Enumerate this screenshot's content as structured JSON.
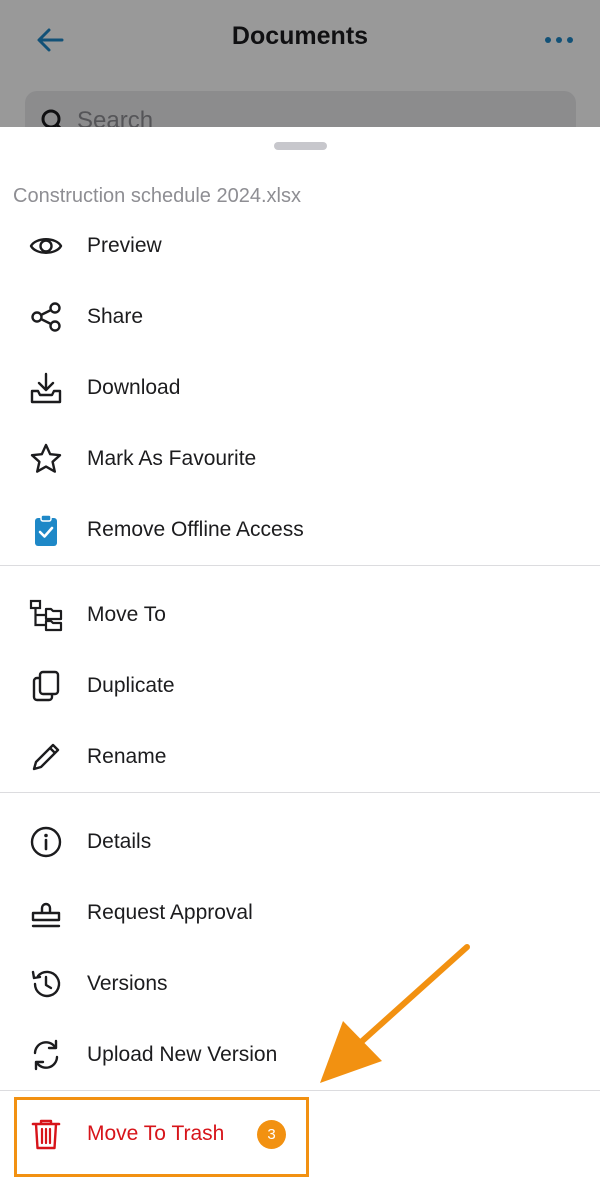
{
  "header": {
    "title": "Documents",
    "back_icon": "arrow-left-icon",
    "more_icon": "more-horizontal-icon"
  },
  "search": {
    "placeholder": "Search",
    "icon": "search-icon"
  },
  "sheet": {
    "file_name": "Construction schedule 2024.xlsx",
    "groups": [
      [
        {
          "label": "Preview",
          "icon": "eye-icon"
        },
        {
          "label": "Share",
          "icon": "share-icon"
        },
        {
          "label": "Download",
          "icon": "download-icon"
        },
        {
          "label": "Mark As Favourite",
          "icon": "star-icon"
        },
        {
          "label": "Remove Offline Access",
          "icon": "clipboard-check-icon"
        }
      ],
      [
        {
          "label": "Move To",
          "icon": "move-folder-icon"
        },
        {
          "label": "Duplicate",
          "icon": "duplicate-icon"
        },
        {
          "label": "Rename",
          "icon": "pencil-icon"
        }
      ],
      [
        {
          "label": "Details",
          "icon": "info-icon"
        },
        {
          "label": "Request Approval",
          "icon": "stamp-icon"
        },
        {
          "label": "Versions",
          "icon": "history-icon"
        },
        {
          "label": "Upload New Version",
          "icon": "refresh-icon"
        }
      ],
      [
        {
          "label": "Move To Trash",
          "icon": "trash-icon"
        }
      ]
    ],
    "trash_badge": "3"
  },
  "colors": {
    "accent_blue": "#1e88c7",
    "danger_red": "#d7141a",
    "highlight_orange": "#f29111",
    "secondary_text": "#8e8e93"
  }
}
